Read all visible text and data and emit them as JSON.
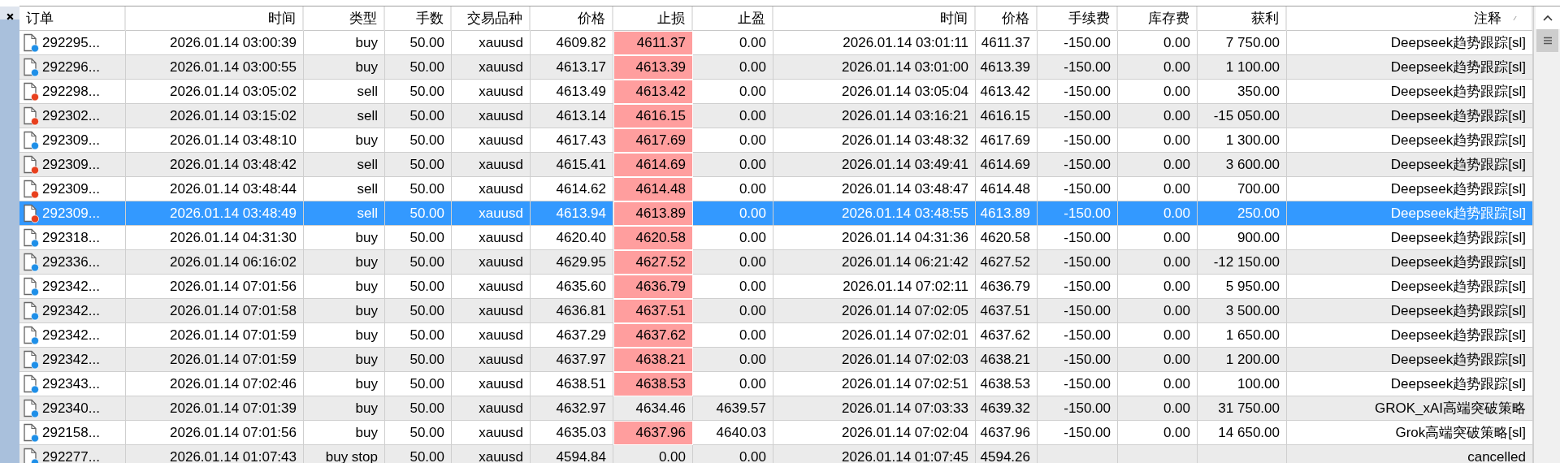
{
  "table": {
    "columns": [
      {
        "label": "订单",
        "sorted": false
      },
      {
        "label": "时间",
        "sorted": false
      },
      {
        "label": "类型",
        "sorted": false
      },
      {
        "label": "手数",
        "sorted": false
      },
      {
        "label": "交易品种",
        "sorted": false
      },
      {
        "label": "价格",
        "sorted": false
      },
      {
        "label": "止损",
        "sorted": false
      },
      {
        "label": "止盈",
        "sorted": false
      },
      {
        "label": "时间",
        "sorted": false
      },
      {
        "label": "价格",
        "sorted": false
      },
      {
        "label": "手续费",
        "sorted": false
      },
      {
        "label": "库存费",
        "sorted": false
      },
      {
        "label": "获利",
        "sorted": false
      },
      {
        "label": "注释",
        "sorted": true
      }
    ],
    "rows": [
      {
        "kind": "buy",
        "selected": false,
        "sl_hit": true,
        "cells": [
          "292295...",
          "2026.01.14 03:00:39",
          "buy",
          "50.00",
          "xauusd",
          "4609.82",
          "4611.37",
          "0.00",
          "2026.01.14 03:01:11",
          "4611.37",
          "-150.00",
          "0.00",
          "7 750.00",
          "Deepseek趋势跟踪[sl]"
        ]
      },
      {
        "kind": "buy",
        "selected": false,
        "sl_hit": true,
        "cells": [
          "292296...",
          "2026.01.14 03:00:55",
          "buy",
          "50.00",
          "xauusd",
          "4613.17",
          "4613.39",
          "0.00",
          "2026.01.14 03:01:00",
          "4613.39",
          "-150.00",
          "0.00",
          "1 100.00",
          "Deepseek趋势跟踪[sl]"
        ]
      },
      {
        "kind": "sell",
        "selected": false,
        "sl_hit": true,
        "cells": [
          "292298...",
          "2026.01.14 03:05:02",
          "sell",
          "50.00",
          "xauusd",
          "4613.49",
          "4613.42",
          "0.00",
          "2026.01.14 03:05:04",
          "4613.42",
          "-150.00",
          "0.00",
          "350.00",
          "Deepseek趋势跟踪[sl]"
        ]
      },
      {
        "kind": "sell",
        "selected": false,
        "sl_hit": true,
        "cells": [
          "292302...",
          "2026.01.14 03:15:02",
          "sell",
          "50.00",
          "xauusd",
          "4613.14",
          "4616.15",
          "0.00",
          "2026.01.14 03:16:21",
          "4616.15",
          "-150.00",
          "0.00",
          "-15 050.00",
          "Deepseek趋势跟踪[sl]"
        ]
      },
      {
        "kind": "buy",
        "selected": false,
        "sl_hit": true,
        "cells": [
          "292309...",
          "2026.01.14 03:48:10",
          "buy",
          "50.00",
          "xauusd",
          "4617.43",
          "4617.69",
          "0.00",
          "2026.01.14 03:48:32",
          "4617.69",
          "-150.00",
          "0.00",
          "1 300.00",
          "Deepseek趋势跟踪[sl]"
        ]
      },
      {
        "kind": "sell",
        "selected": false,
        "sl_hit": true,
        "cells": [
          "292309...",
          "2026.01.14 03:48:42",
          "sell",
          "50.00",
          "xauusd",
          "4615.41",
          "4614.69",
          "0.00",
          "2026.01.14 03:49:41",
          "4614.69",
          "-150.00",
          "0.00",
          "3 600.00",
          "Deepseek趋势跟踪[sl]"
        ]
      },
      {
        "kind": "sell",
        "selected": false,
        "sl_hit": true,
        "cells": [
          "292309...",
          "2026.01.14 03:48:44",
          "sell",
          "50.00",
          "xauusd",
          "4614.62",
          "4614.48",
          "0.00",
          "2026.01.14 03:48:47",
          "4614.48",
          "-150.00",
          "0.00",
          "700.00",
          "Deepseek趋势跟踪[sl]"
        ]
      },
      {
        "kind": "sell",
        "selected": true,
        "sl_hit": true,
        "cells": [
          "292309...",
          "2026.01.14 03:48:49",
          "sell",
          "50.00",
          "xauusd",
          "4613.94",
          "4613.89",
          "0.00",
          "2026.01.14 03:48:55",
          "4613.89",
          "-150.00",
          "0.00",
          "250.00",
          "Deepseek趋势跟踪[sl]"
        ]
      },
      {
        "kind": "buy",
        "selected": false,
        "sl_hit": true,
        "cells": [
          "292318...",
          "2026.01.14 04:31:30",
          "buy",
          "50.00",
          "xauusd",
          "4620.40",
          "4620.58",
          "0.00",
          "2026.01.14 04:31:36",
          "4620.58",
          "-150.00",
          "0.00",
          "900.00",
          "Deepseek趋势跟踪[sl]"
        ]
      },
      {
        "kind": "buy",
        "selected": false,
        "sl_hit": true,
        "cells": [
          "292336...",
          "2026.01.14 06:16:02",
          "buy",
          "50.00",
          "xauusd",
          "4629.95",
          "4627.52",
          "0.00",
          "2026.01.14 06:21:42",
          "4627.52",
          "-150.00",
          "0.00",
          "-12 150.00",
          "Deepseek趋势跟踪[sl]"
        ]
      },
      {
        "kind": "buy",
        "selected": false,
        "sl_hit": true,
        "cells": [
          "292342...",
          "2026.01.14 07:01:56",
          "buy",
          "50.00",
          "xauusd",
          "4635.60",
          "4636.79",
          "0.00",
          "2026.01.14 07:02:11",
          "4636.79",
          "-150.00",
          "0.00",
          "5 950.00",
          "Deepseek趋势跟踪[sl]"
        ]
      },
      {
        "kind": "buy",
        "selected": false,
        "sl_hit": true,
        "cells": [
          "292342...",
          "2026.01.14 07:01:58",
          "buy",
          "50.00",
          "xauusd",
          "4636.81",
          "4637.51",
          "0.00",
          "2026.01.14 07:02:05",
          "4637.51",
          "-150.00",
          "0.00",
          "3 500.00",
          "Deepseek趋势跟踪[sl]"
        ]
      },
      {
        "kind": "buy",
        "selected": false,
        "sl_hit": true,
        "cells": [
          "292342...",
          "2026.01.14 07:01:59",
          "buy",
          "50.00",
          "xauusd",
          "4637.29",
          "4637.62",
          "0.00",
          "2026.01.14 07:02:01",
          "4637.62",
          "-150.00",
          "0.00",
          "1 650.00",
          "Deepseek趋势跟踪[sl]"
        ]
      },
      {
        "kind": "buy",
        "selected": false,
        "sl_hit": true,
        "cells": [
          "292342...",
          "2026.01.14 07:01:59",
          "buy",
          "50.00",
          "xauusd",
          "4637.97",
          "4638.21",
          "0.00",
          "2026.01.14 07:02:03",
          "4638.21",
          "-150.00",
          "0.00",
          "1 200.00",
          "Deepseek趋势跟踪[sl]"
        ]
      },
      {
        "kind": "buy",
        "selected": false,
        "sl_hit": true,
        "cells": [
          "292343...",
          "2026.01.14 07:02:46",
          "buy",
          "50.00",
          "xauusd",
          "4638.51",
          "4638.53",
          "0.00",
          "2026.01.14 07:02:51",
          "4638.53",
          "-150.00",
          "0.00",
          "100.00",
          "Deepseek趋势跟踪[sl]"
        ]
      },
      {
        "kind": "buy",
        "selected": false,
        "sl_hit": false,
        "cells": [
          "292340...",
          "2026.01.14 07:01:39",
          "buy",
          "50.00",
          "xauusd",
          "4632.97",
          "4634.46",
          "4639.57",
          "2026.01.14 07:03:33",
          "4639.32",
          "-150.00",
          "0.00",
          "31 750.00",
          "GROK_xAI高端突破策略"
        ]
      },
      {
        "kind": "buy",
        "selected": false,
        "sl_hit": true,
        "cells": [
          "292158...",
          "2026.01.14 07:01:56",
          "buy",
          "50.00",
          "xauusd",
          "4635.03",
          "4637.96",
          "4640.03",
          "2026.01.14 07:02:04",
          "4637.96",
          "-150.00",
          "0.00",
          "14 650.00",
          "Grok高端突破策略[sl]"
        ]
      },
      {
        "kind": "buy",
        "selected": false,
        "sl_hit": false,
        "cells": [
          "292277...",
          "2026.01.14 01:07:43",
          "buy stop",
          "50.00",
          "xauusd",
          "4594.84",
          "0.00",
          "0.00",
          "2026.01.14 01:07:45",
          "4594.26",
          null,
          null,
          null,
          "cancelled"
        ]
      }
    ]
  }
}
